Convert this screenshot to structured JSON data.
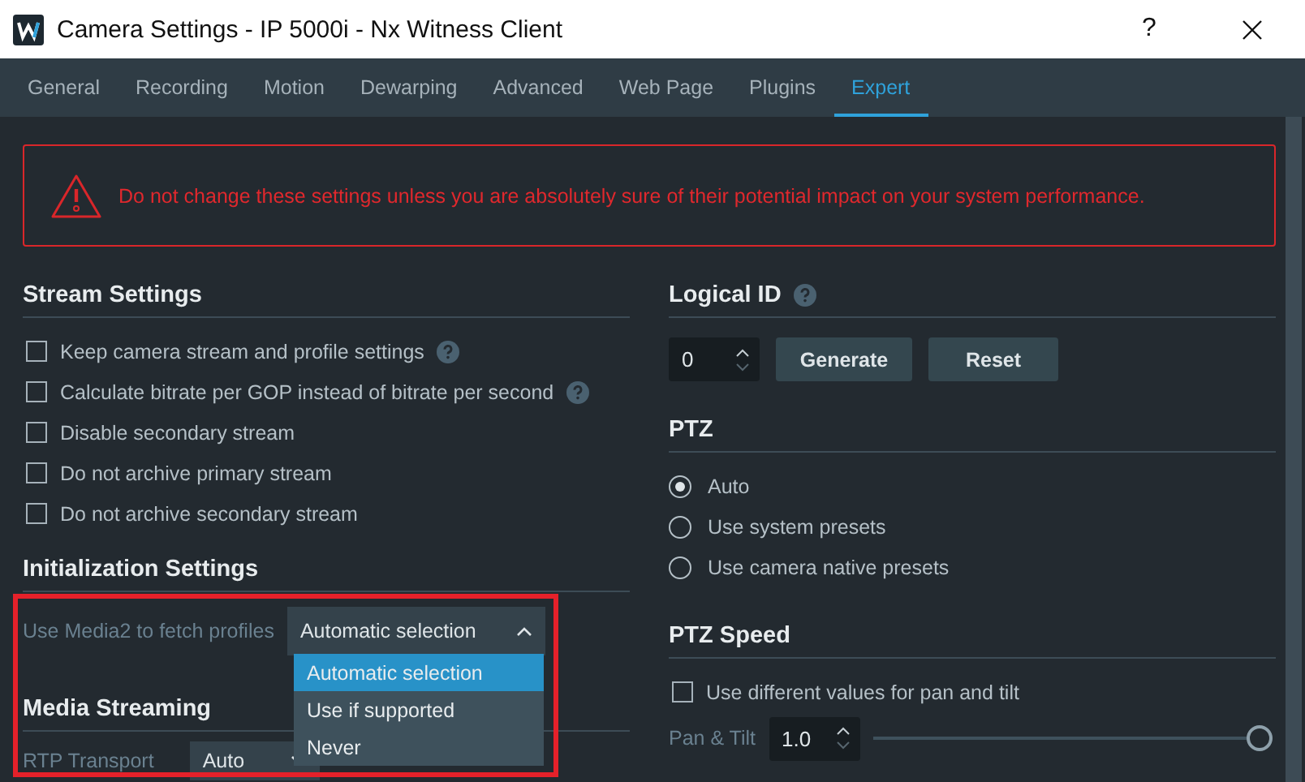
{
  "window": {
    "title": "Camera Settings - IP 5000i - Nx Witness Client",
    "help": "?"
  },
  "tabs": [
    {
      "label": "General",
      "selected": false
    },
    {
      "label": "Recording",
      "selected": false
    },
    {
      "label": "Motion",
      "selected": false
    },
    {
      "label": "Dewarping",
      "selected": false
    },
    {
      "label": "Advanced",
      "selected": false
    },
    {
      "label": "Web Page",
      "selected": false
    },
    {
      "label": "Plugins",
      "selected": false
    },
    {
      "label": "Expert",
      "selected": true
    }
  ],
  "warning": "Do not change these settings unless you are absolutely sure of their potential impact on your system performance.",
  "stream_settings": {
    "heading": "Stream Settings",
    "options": [
      {
        "label": "Keep camera stream and profile settings",
        "checked": false,
        "help": true
      },
      {
        "label": "Calculate bitrate per GOP instead of bitrate per second",
        "checked": false,
        "help": true
      },
      {
        "label": "Disable secondary stream",
        "checked": false,
        "help": false
      },
      {
        "label": "Do not archive primary stream",
        "checked": false,
        "help": false
      },
      {
        "label": "Do not archive secondary stream",
        "checked": false,
        "help": false
      }
    ]
  },
  "initialization_settings": {
    "heading": "Initialization Settings",
    "label": "Use Media2 to fetch profiles",
    "value": "Automatic selection",
    "expanded": true,
    "options": [
      {
        "label": "Automatic selection",
        "selected": true
      },
      {
        "label": "Use if supported",
        "selected": false
      },
      {
        "label": "Never",
        "selected": false
      }
    ]
  },
  "media_streaming": {
    "heading": "Media Streaming",
    "label": "RTP Transport",
    "value": "Auto"
  },
  "logical_id": {
    "heading": "Logical ID",
    "help": true,
    "value": "0",
    "buttons": [
      "Generate",
      "Reset"
    ]
  },
  "ptz": {
    "heading": "PTZ",
    "options": [
      {
        "label": "Auto",
        "selected": true
      },
      {
        "label": "Use system presets",
        "selected": false
      },
      {
        "label": "Use camera native presets",
        "selected": false
      }
    ]
  },
  "ptz_speed": {
    "heading": "PTZ Speed",
    "checkbox": {
      "label": "Use different values for pan and tilt",
      "checked": false
    },
    "pan_tilt": {
      "label": "Pan & Tilt",
      "value": "1.0",
      "level": 1
    }
  }
}
